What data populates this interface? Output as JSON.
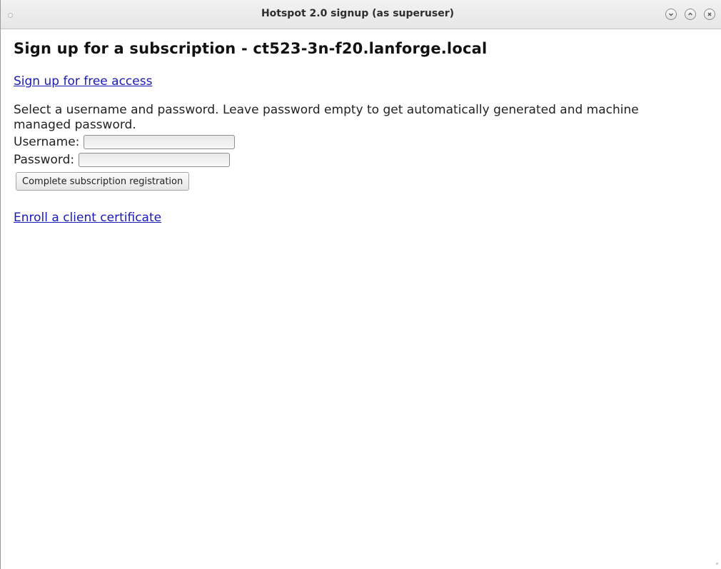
{
  "window": {
    "title": "Hotspot 2.0 signup (as superuser)",
    "controls": [
      "minimize-icon",
      "maximize-icon",
      "close-icon"
    ]
  },
  "page": {
    "heading": "Sign up for a subscription - ct523-3n-f20.lanforge.local",
    "free_access_link": "Sign up for free access",
    "instructions": "Select a username and password. Leave password empty to get automatically generated and machine managed password.",
    "username_label": "Username:",
    "username_value": "",
    "password_label": "Password:",
    "password_value": "",
    "submit_label": "Complete subscription registration",
    "enroll_link": "Enroll a client certificate"
  },
  "colors": {
    "link": "#1a1ab4",
    "text": "#222222",
    "titlebar": "#ececec"
  }
}
